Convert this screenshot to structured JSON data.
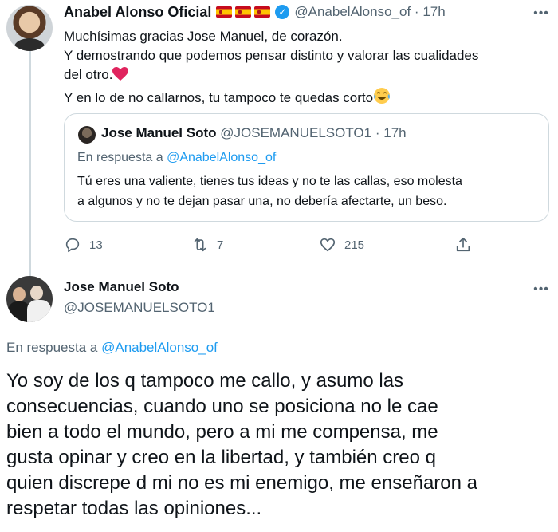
{
  "tweet1": {
    "author_name": "Anabel Alonso Oficial",
    "author_handle": "@AnabelAlonso_of",
    "separator": "·",
    "time": "17h",
    "text_lines": [
      "Muchísimas gracias Jose Manuel, de corazón.",
      "Y demostrando que podemos pensar distinto y valorar las cualidades",
      "del otro.",
      "Y en lo de no callarnos, tu tampoco te quedas corto"
    ],
    "emojis": [
      "❤️",
      "😂"
    ],
    "quoted": {
      "author_name": "Jose Manuel Soto",
      "author_handle": "@JOSEMANUELSOTO1",
      "time": "17h",
      "reply_prefix": "En respuesta a",
      "reply_to": "@AnabelAlonso_of",
      "text_lines": [
        "Tú eres una valiente, tienes tus ideas y no te las callas, eso molesta",
        "a algunos y no te dejan pasar una, no debería afectarte, un beso."
      ]
    },
    "stats": {
      "replies": "13",
      "retweets": "7",
      "likes": "215"
    },
    "icons": {
      "reply": "reply-icon",
      "retweet": "retweet-icon",
      "like": "heart-icon",
      "share": "share-icon",
      "more": "more-icon"
    }
  },
  "tweet2": {
    "author_name": "Jose Manuel Soto",
    "author_handle": "@JOSEMANUELSOTO1",
    "reply_prefix": "En respuesta a",
    "reply_to": "@AnabelAlonso_of",
    "text_lines": [
      "Yo soy de los q tampoco me callo, y asumo las",
      "consecuencias, cuando uno se posiciona no le cae",
      "bien a todo el mundo, pero a mi me compensa, me",
      "gusta opinar y creo en la libertad, y también creo q",
      "quien discrepe d mi no es mi enemigo, me enseñaron a",
      "respetar todas las opiniones..."
    ]
  },
  "colors": {
    "accent": "#1d9bf0",
    "muted": "#536471",
    "border": "#cfd9de",
    "text": "#0f1419",
    "heart": "#e0245e"
  }
}
